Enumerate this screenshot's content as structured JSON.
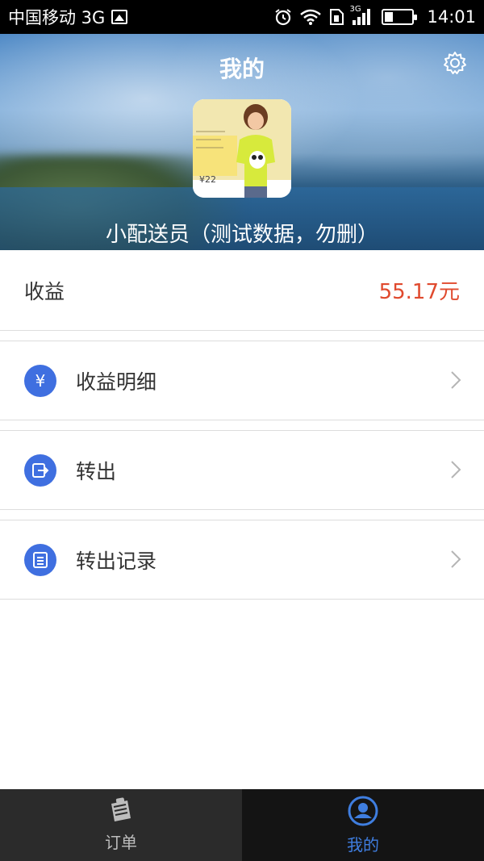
{
  "status_bar": {
    "carrier": "中国移动 3G",
    "network_small": "3G",
    "time": "14:01"
  },
  "header": {
    "title": "我的",
    "user_name": "小配送员（测试数据，勿删）",
    "avatar_price_text": "¥22"
  },
  "earnings": {
    "label": "收益",
    "value": "55.17元"
  },
  "menu": [
    {
      "label": "收益明细",
      "icon": "yen-icon",
      "icon_glyph": "¥"
    },
    {
      "label": "转出",
      "icon": "transfer-out-icon"
    },
    {
      "label": "转出记录",
      "icon": "record-list-icon"
    }
  ],
  "tabs": [
    {
      "label": "订单",
      "icon": "orders-icon",
      "active": false
    },
    {
      "label": "我的",
      "icon": "profile-icon",
      "active": true
    }
  ],
  "colors": {
    "accent": "#3f6fe0",
    "earnings_value": "#e04a2e",
    "tab_active": "#3f7ee0",
    "tab_inactive": "#bdbdbd"
  }
}
